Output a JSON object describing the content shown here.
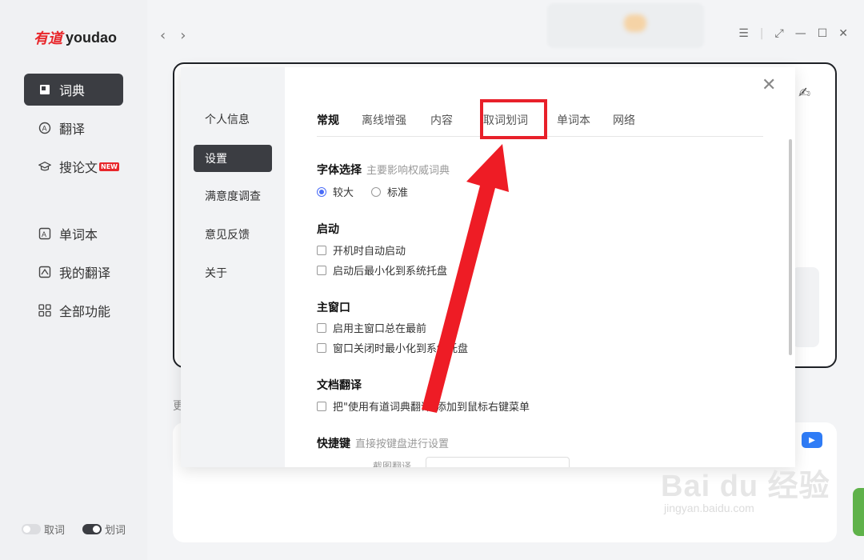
{
  "app": {
    "logo_cn": "有道",
    "logo_en": "youdao"
  },
  "sidebar": {
    "items": [
      {
        "label": "词典",
        "icon": "book-icon",
        "active": true
      },
      {
        "label": "翻译",
        "icon": "translate-icon",
        "active": false
      },
      {
        "label": "搜论文",
        "icon": "graduation-cap-icon",
        "badge": "NEW",
        "active": false
      },
      {
        "label": "单词本",
        "icon": "wordbook-icon",
        "active": false
      },
      {
        "label": "我的翻译",
        "icon": "my-translation-icon",
        "active": false
      },
      {
        "label": "全部功能",
        "icon": "grid-icon",
        "active": false
      }
    ],
    "toggles": [
      {
        "label": "取词",
        "on": false
      },
      {
        "label": "划词",
        "on": true
      }
    ]
  },
  "main": {
    "more_label": "更"
  },
  "dialog": {
    "side_items": [
      {
        "label": "个人信息",
        "active": false
      },
      {
        "label": "设置",
        "active": true
      },
      {
        "label": "满意度调查",
        "active": false
      },
      {
        "label": "意见反馈",
        "active": false
      },
      {
        "label": "关于",
        "active": false
      }
    ],
    "tabs": [
      {
        "label": "常规",
        "active": true
      },
      {
        "label": "离线增强",
        "active": false
      },
      {
        "label": "内容",
        "active": false
      },
      {
        "label": "取词划词",
        "active": false,
        "highlighted": true
      },
      {
        "label": "单词本",
        "active": false
      },
      {
        "label": "网络",
        "active": false
      }
    ],
    "font_section": {
      "title": "字体选择",
      "subtitle": "主要影响权威词典",
      "options": [
        {
          "label": "较大",
          "selected": true
        },
        {
          "label": "标准",
          "selected": false
        }
      ]
    },
    "startup_section": {
      "title": "启动",
      "options": [
        "开机时自动启动",
        "启动后最小化到系统托盘"
      ]
    },
    "mainwindow_section": {
      "title": "主窗口",
      "options": [
        "启用主窗口总在最前",
        "窗口关闭时最小化到系统托盘"
      ]
    },
    "doc_section": {
      "title": "文档翻译",
      "options": [
        "把\"使用有道词典翻译\"添加到鼠标右键菜单"
      ]
    },
    "hotkey_section": {
      "title": "快捷键",
      "subtitle": "直接按键盘进行设置",
      "first_label": "截图翻译"
    }
  },
  "watermark": {
    "brand": "Bai du 经验",
    "url": "jingyan.baidu.com"
  },
  "colors": {
    "highlight": "#e8202a",
    "active_nav": "#3b3d42",
    "radio_accent": "#4a6cf7"
  }
}
